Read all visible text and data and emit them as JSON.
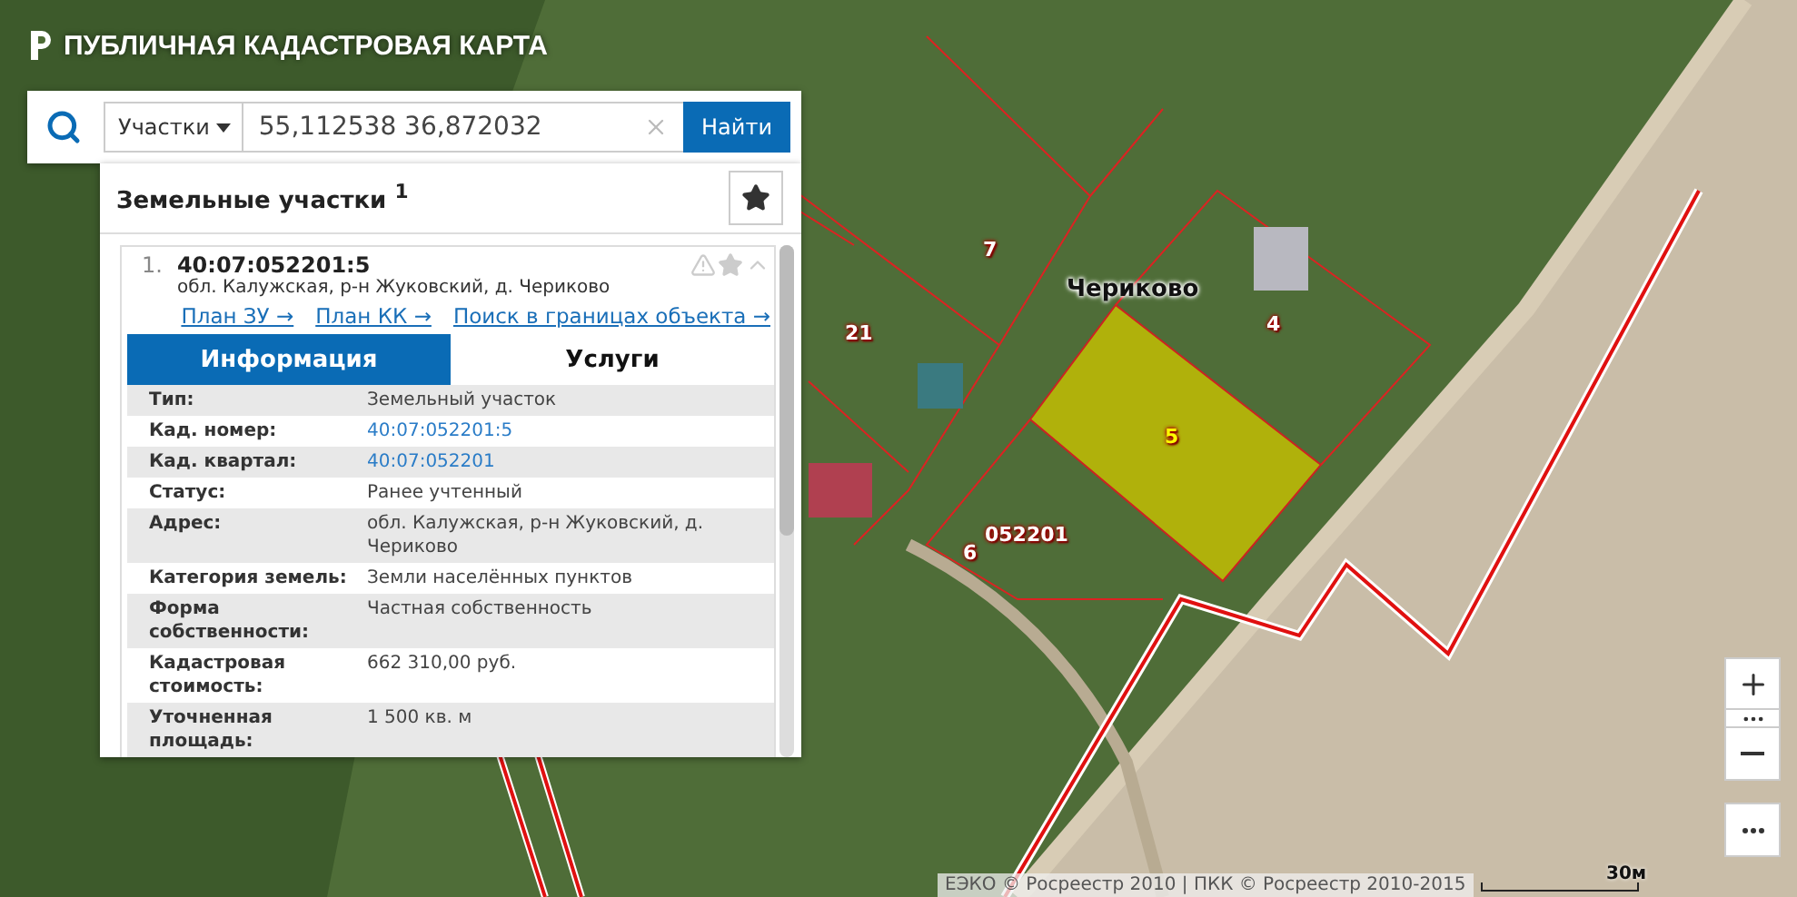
{
  "header": {
    "title": "ПУБЛИЧНАЯ КАДАСТРОВАЯ КАРТА"
  },
  "search": {
    "category": "Участки",
    "value": "55,112538 36,872032",
    "button": "Найти"
  },
  "results": {
    "title": "Земельные участки $^{1}$",
    "items": [
      {
        "number": "1.",
        "cadastral": "40:07:052201:5",
        "address": "обл. Калужская, р-н Жуковский, д. Чериково",
        "links": [
          "План ЗУ →",
          "План КК →",
          "Поиск в границах объекта →"
        ],
        "tabs": [
          {
            "label": "Информация",
            "selected": true
          },
          {
            "label": "Услуги",
            "selected": false
          }
        ],
        "attributes": [
          {
            "label": "Тип:",
            "value": "Земельный участок",
            "kind": "text"
          },
          {
            "label": "Кад. номер:",
            "value": "40:07:052201:5",
            "kind": "link"
          },
          {
            "label": "Кад. квартал:",
            "value": "40:07:052201",
            "kind": "link"
          },
          {
            "label": "Статус:",
            "value": "Ранее учтенный",
            "kind": "text"
          },
          {
            "label": "Адрес:",
            "value": "обл. Калужская, р-н Жуковский, д. Чериково",
            "kind": "text"
          },
          {
            "label": "Категория земель:",
            "value": "Земли населённых пунктов",
            "kind": "text"
          },
          {
            "label": "Форма собственности:",
            "value": "Частная собственность",
            "kind": "text"
          },
          {
            "label": "Кадастровая стоимость:",
            "value": "662 310,00 руб.",
            "kind": "text"
          },
          {
            "label": "Уточненная площадь:",
            "value": "1 500 кв. м",
            "kind": "text"
          }
        ]
      }
    ]
  },
  "map": {
    "labels": [
      {
        "text": "7",
        "kind": "parcel"
      },
      {
        "text": "21",
        "kind": "parcel"
      },
      {
        "text": "Чериково",
        "kind": "place"
      },
      {
        "text": "4",
        "kind": "parcel"
      },
      {
        "text": "5",
        "kind": "selected"
      },
      {
        "text": "052201",
        "kind": "quarter"
      },
      {
        "text": "6",
        "kind": "parcel"
      }
    ]
  },
  "attribution": "ЕЭКО © Росреестр 2010 | ПКК © Росреестр 2010-2015",
  "scale": "30м"
}
